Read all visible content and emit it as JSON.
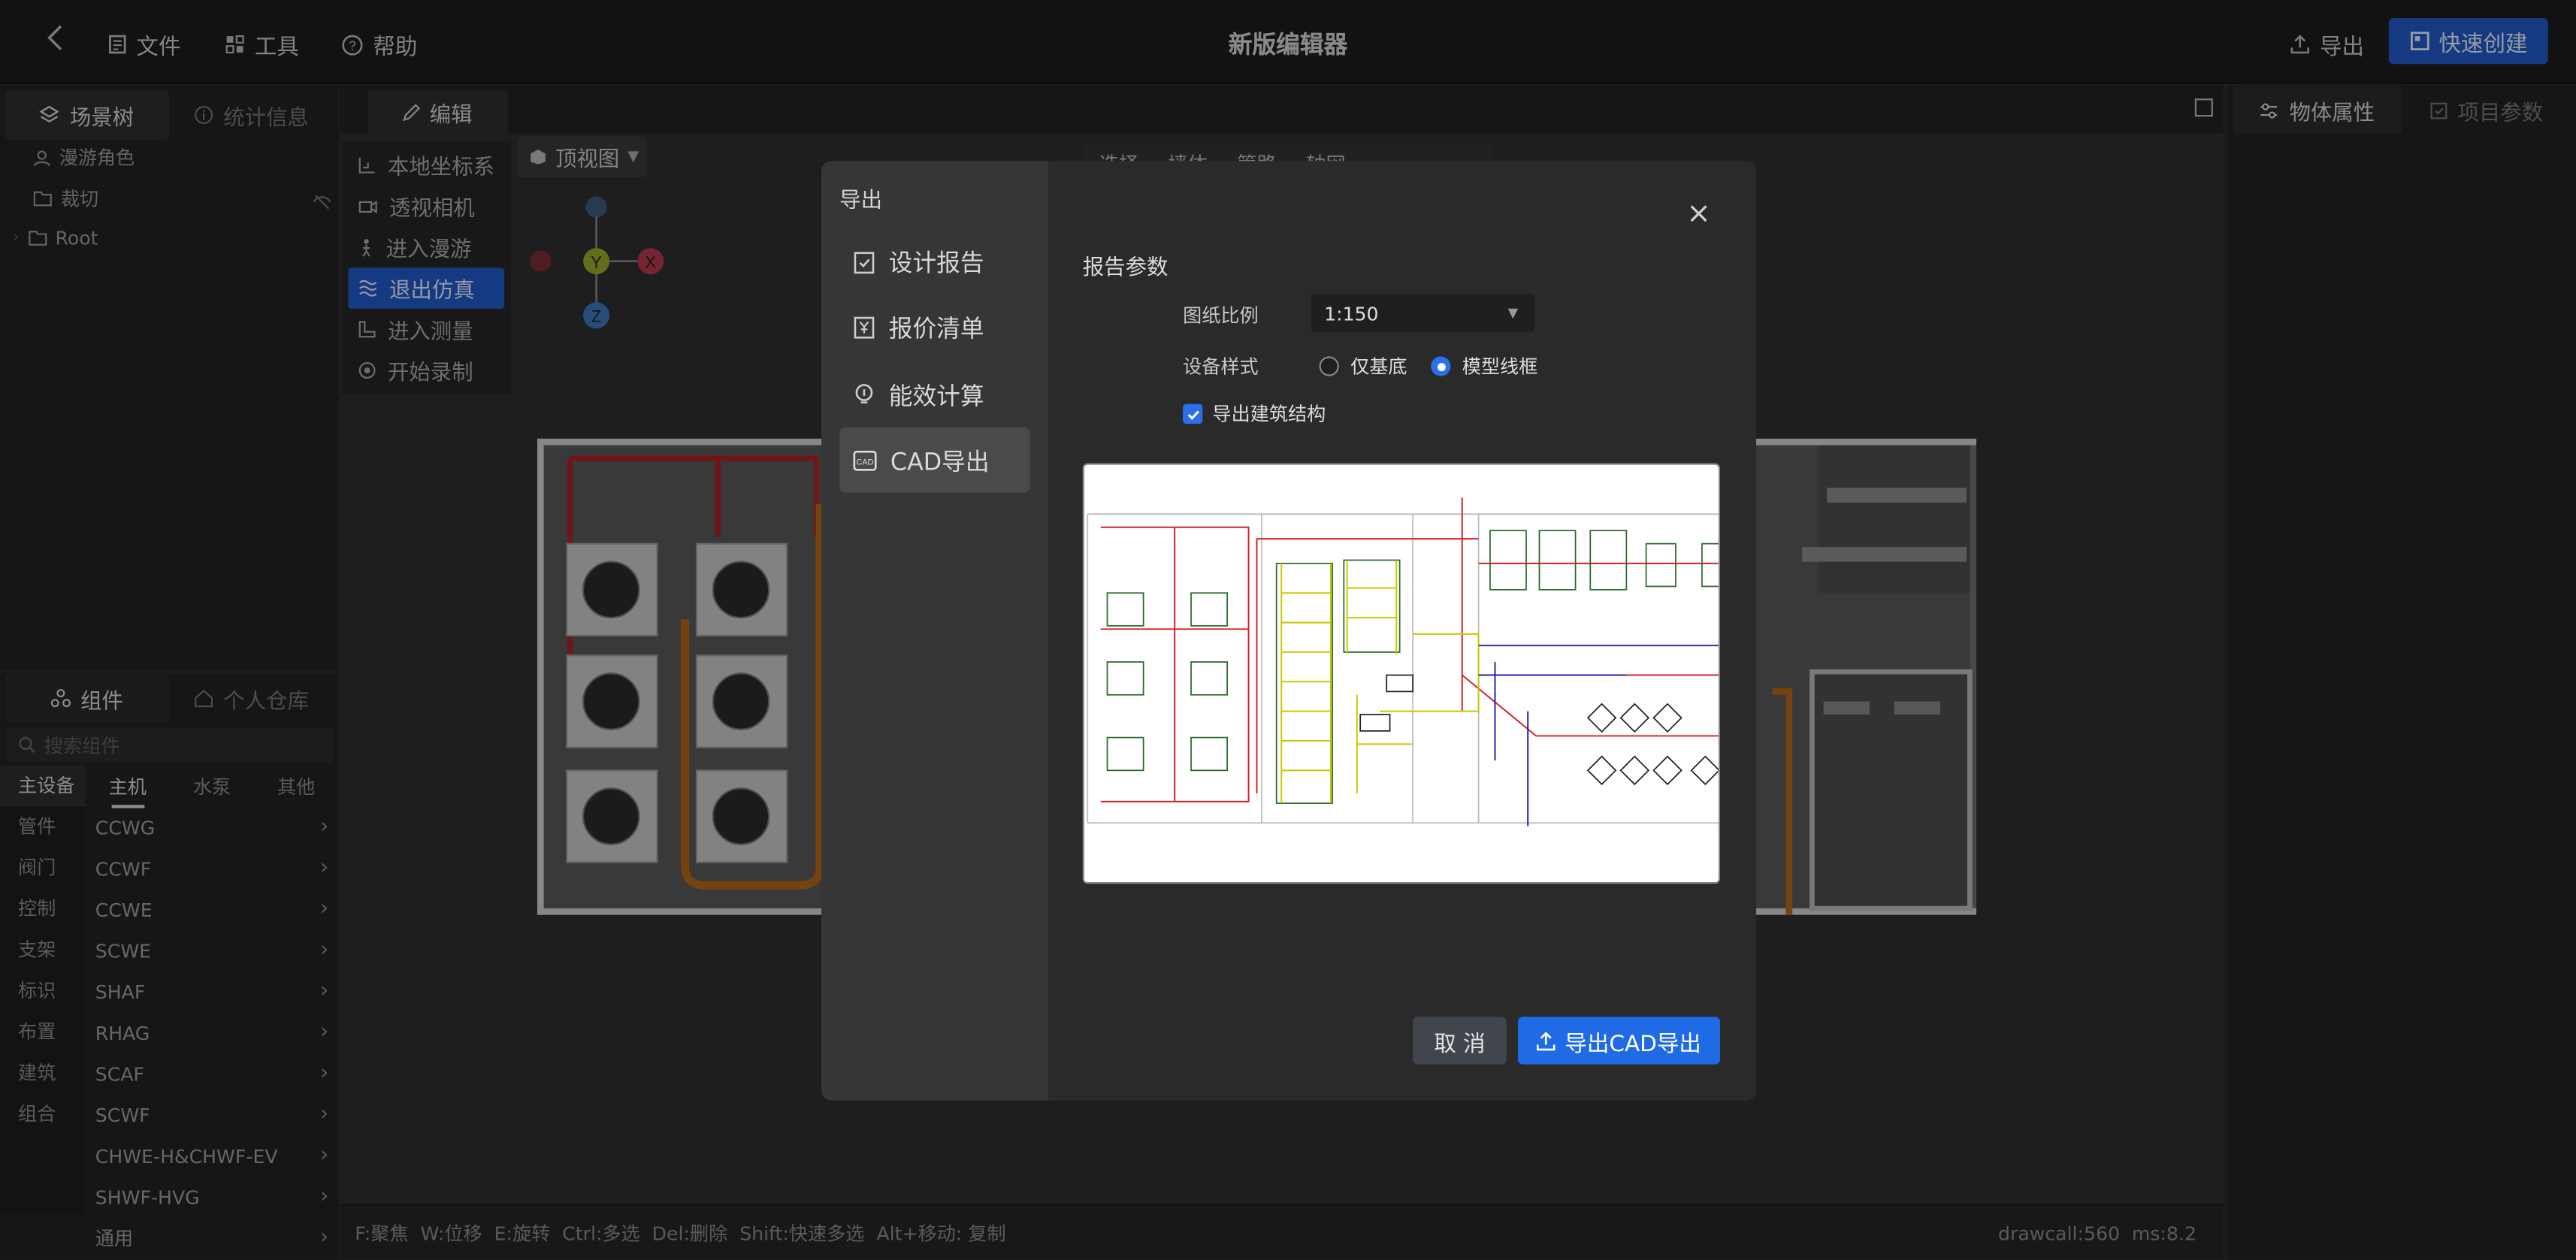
{
  "topbar": {
    "back_icon": "chevron-left-icon",
    "menu": [
      {
        "label": "文件",
        "icon": "file-icon"
      },
      {
        "label": "工具",
        "icon": "tool-icon"
      },
      {
        "label": "帮助",
        "icon": "help-icon"
      }
    ],
    "title": "新版编辑器",
    "export_label": "导出",
    "quick_create_label": "快速创建"
  },
  "left": {
    "tabs": [
      "场景树",
      "统计信息"
    ],
    "tree": [
      "漫游角色",
      "裁切",
      "Root"
    ],
    "component_tabs": [
      "组件",
      "个人仓库"
    ],
    "search_placeholder": "搜索组件",
    "categories": [
      "主设备",
      "管件",
      "阀门",
      "控制",
      "支架",
      "标识",
      "布置",
      "建筑",
      "组合"
    ],
    "sub_tabs": [
      "主机",
      "水泵",
      "其他"
    ],
    "items": [
      "CCWG",
      "CCWF",
      "CCWE",
      "SCWE",
      "SHAF",
      "RHAG",
      "SCAF",
      "SCWF",
      "CHWE-H&CHWF-EV",
      "SHWF-HVG",
      "通用"
    ]
  },
  "edit_tab": "编辑",
  "context_menu": [
    "本地坐标系",
    "透视相机",
    "进入漫游",
    "退出仿真",
    "进入测量",
    "开始录制"
  ],
  "view_dropdown": "顶视图",
  "gizmo": {
    "y": "Y",
    "x": "X",
    "z": "Z"
  },
  "hidden_toolbar": [
    "选择",
    "墙体",
    "管路",
    "轴网"
  ],
  "right_tabs": [
    "物体属性",
    "项目参数"
  ],
  "status": {
    "shortcuts": "F:聚焦  W:位移  E:旋转  Ctrl:多选  Del:删除  Shift:快速多选  Alt+移动: 复制",
    "perf": "drawcall:560  ms:8.2"
  },
  "modal": {
    "title": "导出",
    "nav": [
      "设计报告",
      "报价清单",
      "能效计算",
      "CAD导出"
    ],
    "active_nav": 3,
    "section_title": "报告参数",
    "scale_label": "图纸比例",
    "scale_value": "1:150",
    "style_label": "设备样式",
    "style_options": [
      "仅基底",
      "模型线框"
    ],
    "style_selected": 1,
    "include_structure_label": "导出建筑结构",
    "include_structure_checked": true,
    "cancel_label": "取 消",
    "confirm_label": "导出CAD导出"
  },
  "colors": {
    "accent": "#2159c8",
    "confirm": "#1f6be6"
  }
}
